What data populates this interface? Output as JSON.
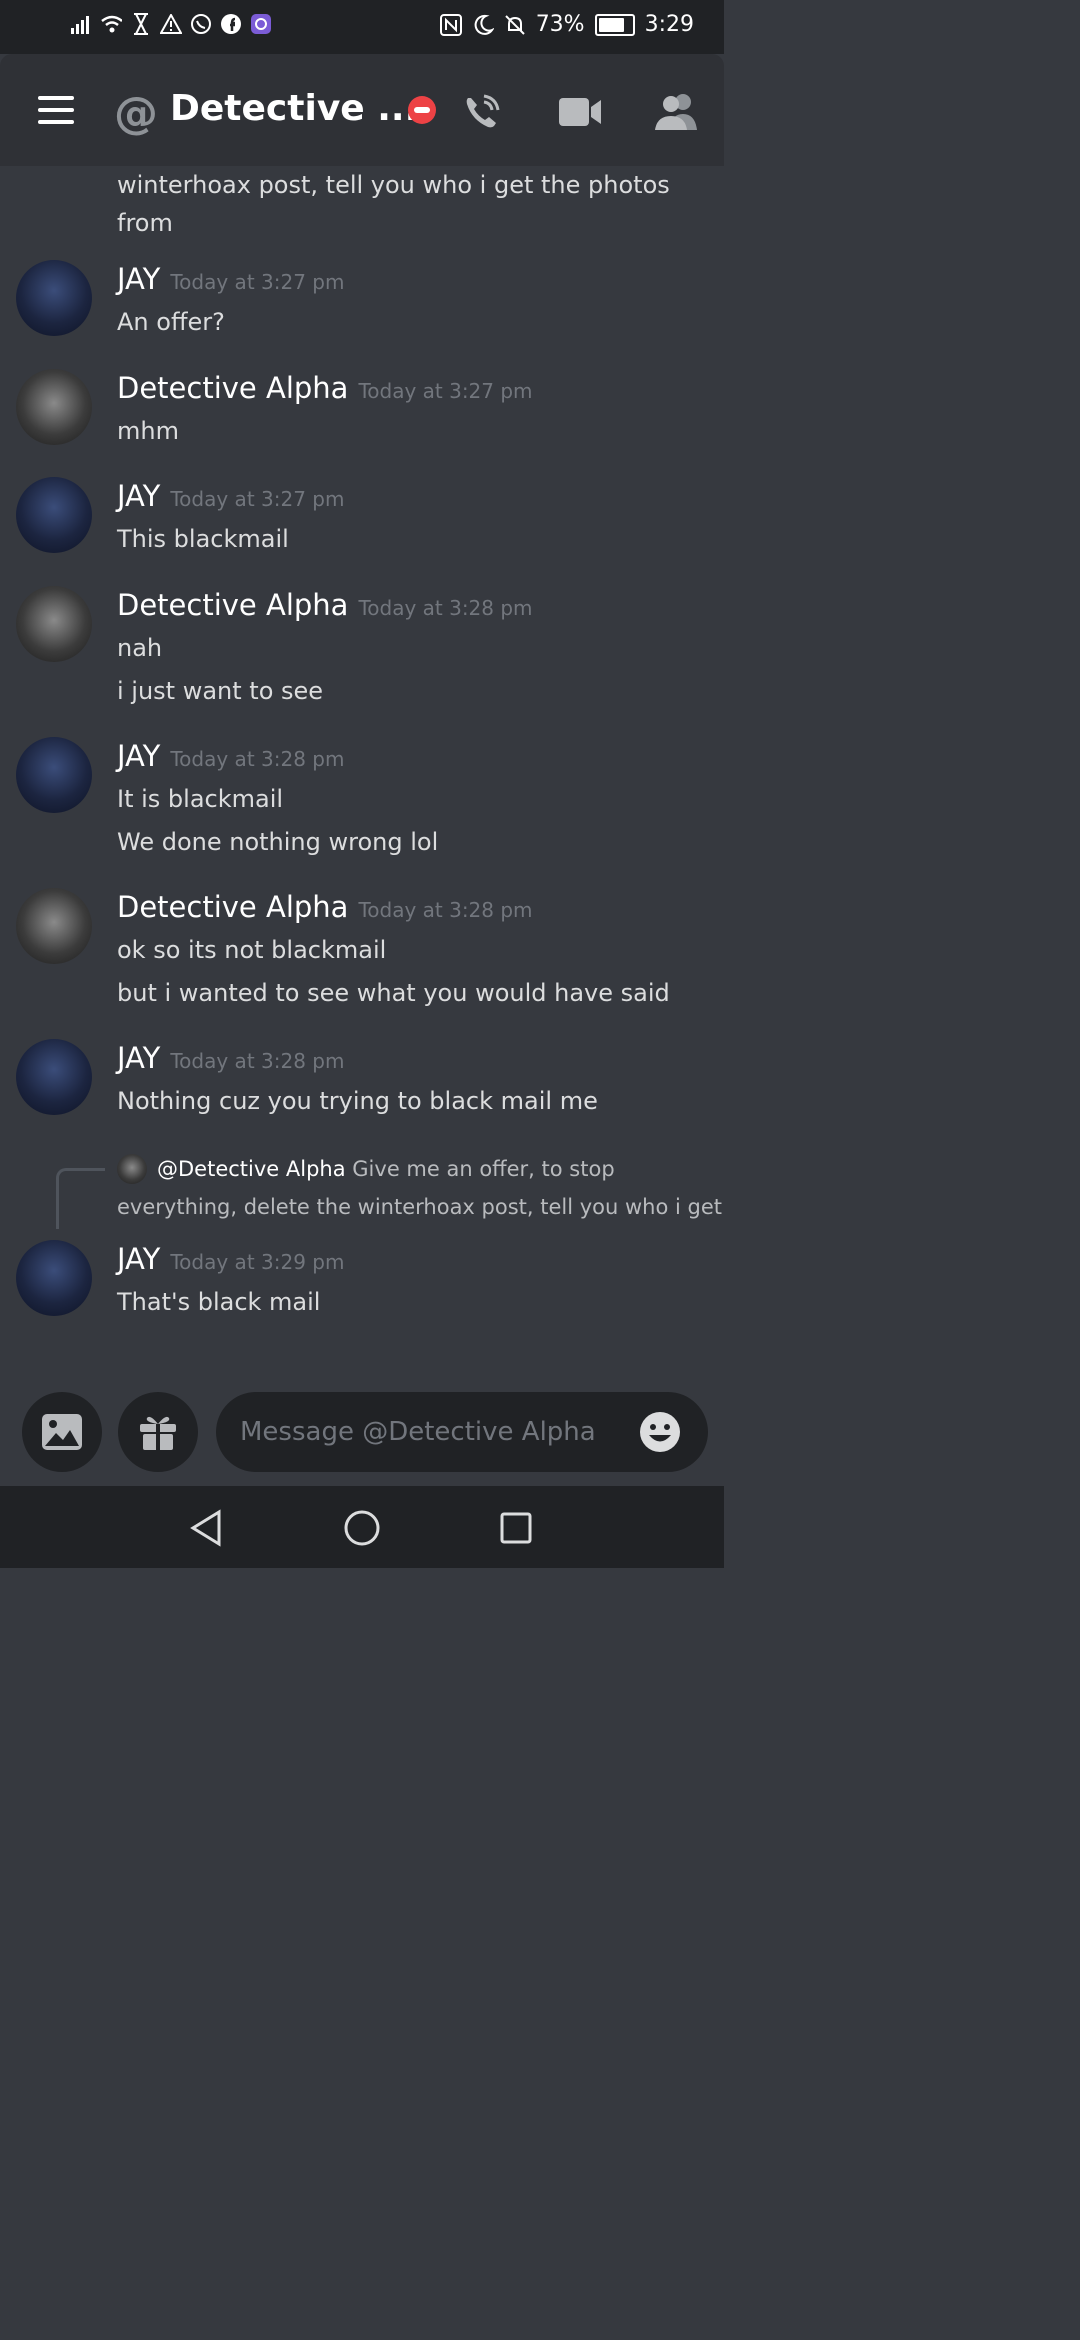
{
  "status_bar": {
    "battery": "73%",
    "time": "3:29"
  },
  "header": {
    "title": "Detective ...",
    "icons": [
      "menu-icon",
      "at-icon",
      "dnd-status-icon",
      "call-icon",
      "video-icon",
      "members-icon"
    ]
  },
  "messages": {
    "continuation": "winterhoax post, tell you who i get the photos from",
    "groups": [
      {
        "author": "JAY",
        "time": "Today at 3:27 pm",
        "lines": [
          "An offer?"
        ]
      },
      {
        "author": "Detective Alpha",
        "time": "Today at 3:27 pm",
        "lines": [
          "mhm"
        ]
      },
      {
        "author": "JAY",
        "time": "Today at 3:27 pm",
        "lines": [
          "This blackmail"
        ]
      },
      {
        "author": "Detective Alpha",
        "time": "Today at 3:28 pm",
        "lines": [
          "nah",
          "i just want to see"
        ]
      },
      {
        "author": "JAY",
        "time": "Today at 3:28 pm",
        "lines": [
          "It is blackmail",
          "We done nothing wrong lol"
        ]
      },
      {
        "author": "Detective Alpha",
        "time": "Today at 3:28 pm",
        "lines": [
          "ok so its not blackmail",
          "but i wanted to see what you would have said"
        ]
      },
      {
        "author": "JAY",
        "time": "Today at 3:28 pm",
        "lines": [
          "Nothing cuz you trying to black mail me"
        ]
      },
      {
        "author": "JAY",
        "time": "Today at 3:29 pm",
        "lines": [
          "That's black mail"
        ]
      }
    ],
    "reply": {
      "name": "@Detective Alpha",
      "text_line1": "Give me an offer, to stop",
      "text_line2": "everything, delete the winterhoax post, tell you who i get"
    }
  },
  "composer": {
    "placeholder": "Message @Detective Alpha"
  },
  "colors": {
    "background": "#36393f",
    "header": "#2f3136",
    "input": "#202225",
    "dnd": "#ed4245",
    "timestamp": "#72767d"
  }
}
